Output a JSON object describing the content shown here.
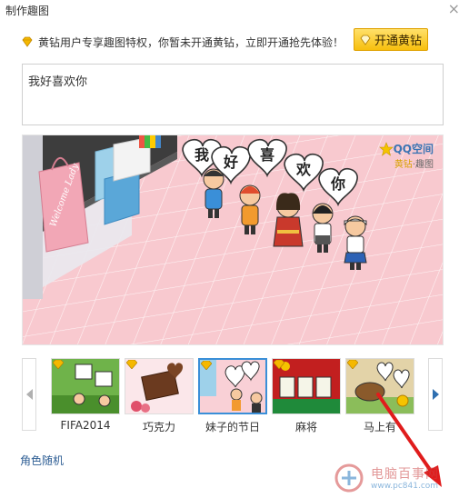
{
  "window": {
    "title": "制作趣图",
    "close_label": "×"
  },
  "notice": {
    "text": "黄钻用户专享趣图特权，你暂未开通黄钻，立即开通抢先体验！",
    "button_label": "开通黄钻"
  },
  "input": {
    "value": "我好喜欢你"
  },
  "preview": {
    "bubble_chars": [
      "我",
      "好",
      "喜",
      "欢",
      "你"
    ],
    "brand": {
      "name": "QQ空间",
      "sub_yellow": "黄钻",
      "sub_rest": "·趣图"
    },
    "sign_text": "Welcome Lady"
  },
  "templates": [
    {
      "label": "FIFA2014",
      "selected": false
    },
    {
      "label": "巧克力",
      "selected": false
    },
    {
      "label": "妹子的节日",
      "selected": true
    },
    {
      "label": "麻将",
      "selected": false
    },
    {
      "label": "马上有",
      "selected": false
    }
  ],
  "random_link": "角色随机",
  "watermark": {
    "text": "电脑百事网",
    "url": "www.pc841.com"
  },
  "colors": {
    "accent": "#3a8fd8",
    "gold": "#f7bf0d",
    "link": "#2e5e94",
    "pink": "#f8c9cf"
  }
}
